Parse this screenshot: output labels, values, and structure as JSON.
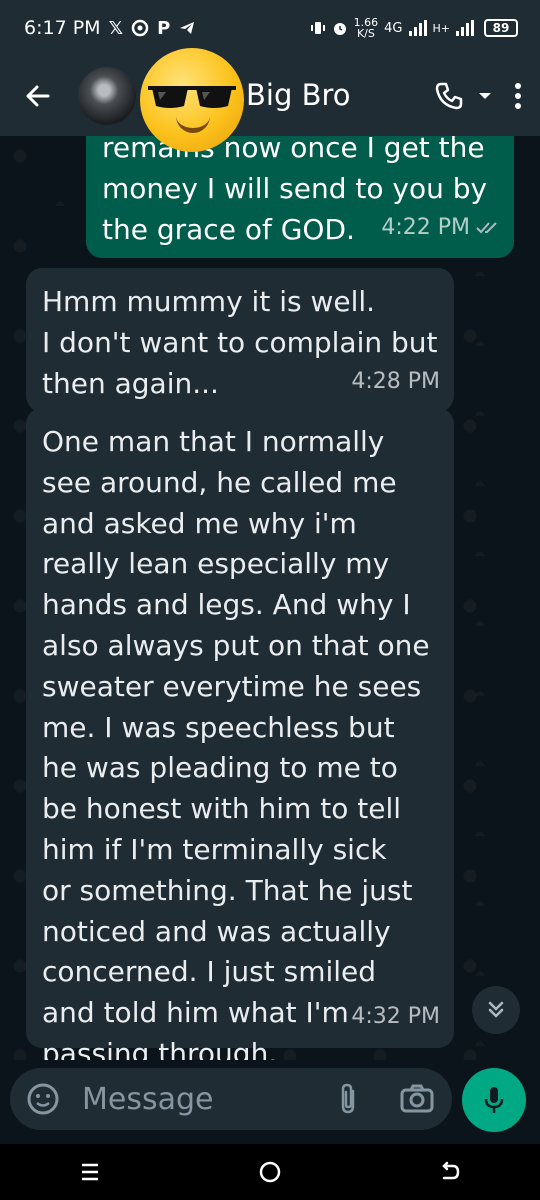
{
  "status_bar": {
    "time": "6:17 PM",
    "notification_icons": [
      "x-icon",
      "threads-icon",
      "paypal-icon",
      "telegram-icon"
    ],
    "net_speed_value": "1.66",
    "net_speed_unit": "K/S",
    "network_type": "4G",
    "network_type_2": "H+",
    "battery_level": "89"
  },
  "app_bar": {
    "contact_name": "Big Bro",
    "emoji_overlay": "sunglasses-emoji"
  },
  "messages": [
    {
      "direction": "outgoing",
      "text": "remains now once I get the\nmoney I will send to you by\nthe grace of GOD.",
      "time": "4:22 PM",
      "status": "read"
    },
    {
      "direction": "incoming",
      "text": "Hmm mummy it is well.\nI don't want to complain but\nthen again...",
      "time": "4:28 PM"
    },
    {
      "direction": "incoming",
      "text": "One man that I normally\nsee around, he called me\nand asked me why i'm\nreally lean especially my\nhands and legs. And why I\nalso always put on that one\nsweater everytime he sees\nme. I was speechless but\nhe was pleading to me to\nbe honest with him to tell\nhim if I'm terminally sick\nor something. That he just\nnoticed and was actually\nconcerned. I just smiled\nand told him what I'm\npassing through.",
      "time": "4:32 PM"
    }
  ],
  "composer": {
    "placeholder": "Message"
  },
  "colors": {
    "header_bg": "#1f2c34",
    "chat_bg": "#0b141a",
    "outgoing_bubble": "#005c4b",
    "incoming_bubble": "#202c33",
    "accent_green": "#00a884",
    "read_ticks": "#53bdeb"
  }
}
